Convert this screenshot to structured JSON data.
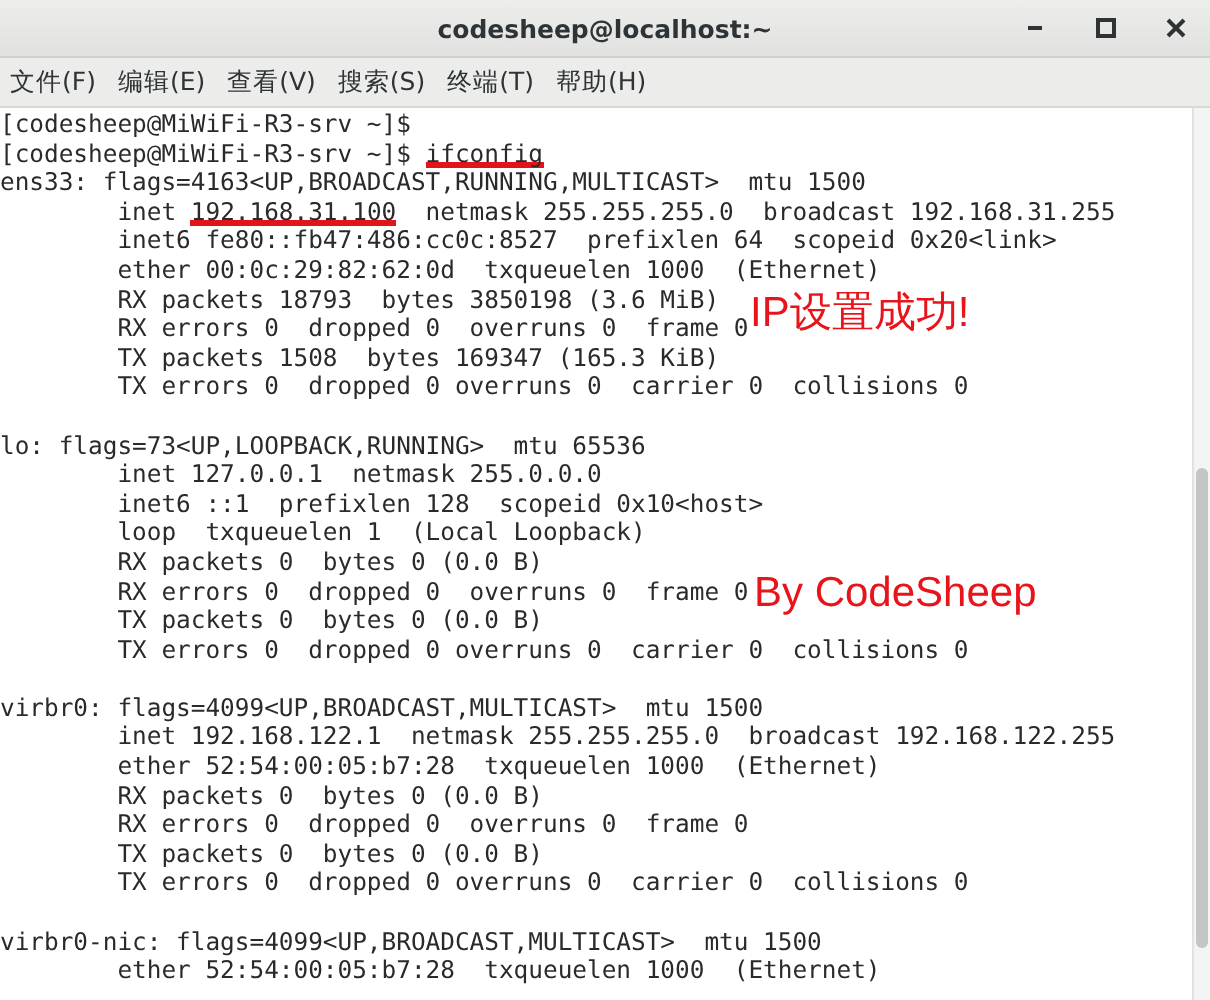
{
  "window": {
    "title": "codesheep@localhost:~"
  },
  "menu": [
    "文件(F)",
    "编辑(E)",
    "查看(V)",
    "搜索(S)",
    "终端(T)",
    "帮助(H)"
  ],
  "terminal": {
    "lines": [
      {
        "parts": [
          {
            "text": "[codesheep@MiWiFi-R3-srv ~]$ ",
            "underlined": false
          }
        ]
      },
      {
        "parts": [
          {
            "text": "[codesheep@MiWiFi-R3-srv ~]$ ",
            "underlined": false
          },
          {
            "text": "ifconfig",
            "underlined": true
          }
        ]
      },
      {
        "parts": [
          {
            "text": "ens33: flags=4163<UP,BROADCAST,RUNNING,MULTICAST>  mtu 1500",
            "underlined": false
          }
        ]
      },
      {
        "parts": [
          {
            "text": "        inet ",
            "underlined": false
          },
          {
            "text": "192.168.31.100",
            "underlined": true
          },
          {
            "text": "  netmask 255.255.255.0  broadcast 192.168.31.255",
            "underlined": false
          }
        ]
      },
      {
        "parts": [
          {
            "text": "        inet6 fe80::fb47:486:cc0c:8527  prefixlen 64  scopeid 0x20<link>",
            "underlined": false
          }
        ]
      },
      {
        "parts": [
          {
            "text": "        ether 00:0c:29:82:62:0d  txqueuelen 1000  (Ethernet)",
            "underlined": false
          }
        ]
      },
      {
        "parts": [
          {
            "text": "        RX packets 18793  bytes 3850198 (3.6 MiB)",
            "underlined": false
          }
        ]
      },
      {
        "parts": [
          {
            "text": "        RX errors 0  dropped 0  overruns 0  frame 0",
            "underlined": false
          }
        ]
      },
      {
        "parts": [
          {
            "text": "        TX packets 1508  bytes 169347 (165.3 KiB)",
            "underlined": false
          }
        ]
      },
      {
        "parts": [
          {
            "text": "        TX errors 0  dropped 0 overruns 0  carrier 0  collisions 0",
            "underlined": false
          }
        ]
      },
      {
        "gap_before": true,
        "parts": [
          {
            "text": "lo: flags=73<UP,LOOPBACK,RUNNING>  mtu 65536",
            "underlined": false
          }
        ]
      },
      {
        "parts": [
          {
            "text": "        inet 127.0.0.1  netmask 255.0.0.0",
            "underlined": false
          }
        ]
      },
      {
        "parts": [
          {
            "text": "        inet6 ::1  prefixlen 128  scopeid 0x10<host>",
            "underlined": false
          }
        ]
      },
      {
        "parts": [
          {
            "text": "        loop  txqueuelen 1  (Local Loopback)",
            "underlined": false
          }
        ]
      },
      {
        "parts": [
          {
            "text": "        RX packets 0  bytes 0 (0.0 B)",
            "underlined": false
          }
        ]
      },
      {
        "parts": [
          {
            "text": "        RX errors 0  dropped 0  overruns 0  frame 0",
            "underlined": false
          }
        ]
      },
      {
        "parts": [
          {
            "text": "        TX packets 0  bytes 0 (0.0 B)",
            "underlined": false
          }
        ]
      },
      {
        "parts": [
          {
            "text": "        TX errors 0  dropped 0 overruns 0  carrier 0  collisions 0",
            "underlined": false
          }
        ]
      },
      {
        "gap_before": true,
        "parts": [
          {
            "text": "virbr0: flags=4099<UP,BROADCAST,MULTICAST>  mtu 1500",
            "underlined": false
          }
        ]
      },
      {
        "parts": [
          {
            "text": "        inet 192.168.122.1  netmask 255.255.255.0  broadcast 192.168.122.255",
            "underlined": false
          }
        ]
      },
      {
        "parts": [
          {
            "text": "        ether 52:54:00:05:b7:28  txqueuelen 1000  (Ethernet)",
            "underlined": false
          }
        ]
      },
      {
        "parts": [
          {
            "text": "        RX packets 0  bytes 0 (0.0 B)",
            "underlined": false
          }
        ]
      },
      {
        "parts": [
          {
            "text": "        RX errors 0  dropped 0  overruns 0  frame 0",
            "underlined": false
          }
        ]
      },
      {
        "parts": [
          {
            "text": "        TX packets 0  bytes 0 (0.0 B)",
            "underlined": false
          }
        ]
      },
      {
        "parts": [
          {
            "text": "        TX errors 0  dropped 0 overruns 0  carrier 0  collisions 0",
            "underlined": false
          }
        ]
      },
      {
        "gap_before": true,
        "parts": [
          {
            "text": "virbr0-nic: flags=4099<UP,BROADCAST,MULTICAST>  mtu 1500",
            "underlined": false
          }
        ]
      },
      {
        "parts": [
          {
            "text": "        ether 52:54:00:05:b7:28  txqueuelen 1000  (Ethernet)",
            "underlined": false
          }
        ]
      }
    ]
  },
  "annotations": [
    "IP设置成功!",
    "By CodeSheep"
  ]
}
